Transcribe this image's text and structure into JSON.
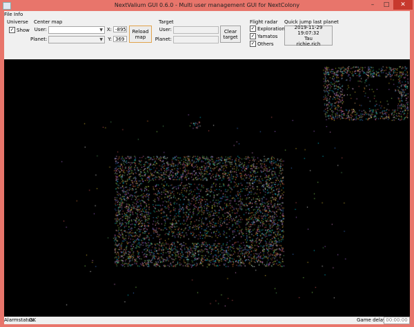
{
  "window": {
    "title": "NextValium GUI 0.6.0 - Multi user management GUI for NextColony",
    "controls": [
      "–",
      "□",
      "✕"
    ]
  },
  "menu": [
    "File",
    "Info"
  ],
  "universe": {
    "title": "Universe",
    "show_label": "Show",
    "show_checked": true
  },
  "center_map": {
    "title": "Center map",
    "user_label": "User:",
    "planet_label": "Planet:",
    "x_label": "X:",
    "x_value": "-895",
    "y_label": "Y:",
    "y_value": "369",
    "reload_label": "Reload map"
  },
  "target": {
    "title": "Target",
    "user_label": "User:",
    "planet_label": "Planet:",
    "clear_label": "Clear target"
  },
  "flight_radar": {
    "title": "Flight radar",
    "options": [
      {
        "label": "Explorations",
        "checked": true
      },
      {
        "label": "Yamatos",
        "checked": true
      },
      {
        "label": "Others",
        "checked": true
      }
    ]
  },
  "quick_jump": {
    "title": "Quick jump last planet",
    "date": "2019-11-29 19:07:32",
    "planet": "Tau",
    "user": "richie.rich"
  },
  "status": {
    "alarm_label": "Alarmstatus:",
    "alarm_value": "OK",
    "delay_label": "Game delay:",
    "delay_value": "00:00:00"
  },
  "map_colors": [
    "#ff6b6b",
    "#ffd93d",
    "#6bcB77",
    "#4d96ff",
    "#c77dff",
    "#ff9ff3",
    "#ffffff",
    "#00e5ff",
    "#ff8c42",
    "#a0ff6b"
  ]
}
